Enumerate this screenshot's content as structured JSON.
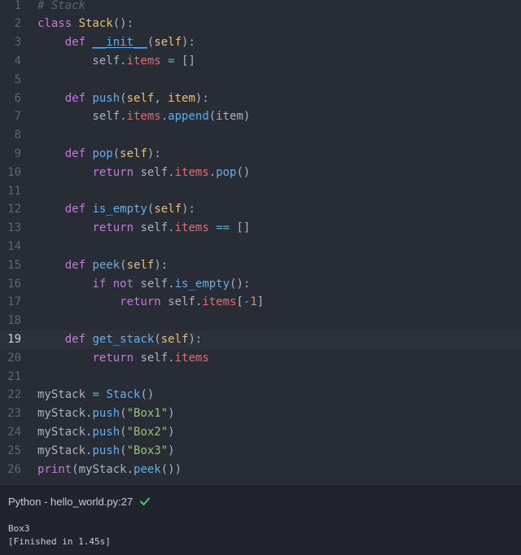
{
  "editor": {
    "active_line": 19,
    "lines": [
      {
        "n": "1",
        "tokens": [
          [
            "comment",
            "# Stack"
          ]
        ]
      },
      {
        "n": "2",
        "tokens": [
          [
            "keyword",
            "class "
          ],
          [
            "class",
            "Stack"
          ],
          [
            "plain",
            "():"
          ]
        ]
      },
      {
        "n": "3",
        "tokens": [
          [
            "plain",
            "    "
          ],
          [
            "keyword",
            "def "
          ],
          [
            "magic",
            "__init__"
          ],
          [
            "plain",
            "("
          ],
          [
            "self",
            "self"
          ],
          [
            "plain",
            "):"
          ]
        ]
      },
      {
        "n": "4",
        "tokens": [
          [
            "plain",
            "        self."
          ],
          [
            "prop",
            "items"
          ],
          [
            "plain",
            " "
          ],
          [
            "op",
            "="
          ],
          [
            "plain",
            " []"
          ]
        ]
      },
      {
        "n": "5",
        "tokens": []
      },
      {
        "n": "6",
        "tokens": [
          [
            "plain",
            "    "
          ],
          [
            "keyword",
            "def "
          ],
          [
            "func",
            "push"
          ],
          [
            "plain",
            "("
          ],
          [
            "self",
            "self"
          ],
          [
            "plain",
            ", "
          ],
          [
            "self",
            "item"
          ],
          [
            "plain",
            "):"
          ]
        ]
      },
      {
        "n": "7",
        "tokens": [
          [
            "plain",
            "        self."
          ],
          [
            "prop",
            "items"
          ],
          [
            "plain",
            "."
          ],
          [
            "func",
            "append"
          ],
          [
            "plain",
            "(item)"
          ]
        ]
      },
      {
        "n": "8",
        "tokens": []
      },
      {
        "n": "9",
        "tokens": [
          [
            "plain",
            "    "
          ],
          [
            "keyword",
            "def "
          ],
          [
            "func",
            "pop"
          ],
          [
            "plain",
            "("
          ],
          [
            "self",
            "self"
          ],
          [
            "plain",
            "):"
          ]
        ]
      },
      {
        "n": "10",
        "tokens": [
          [
            "plain",
            "        "
          ],
          [
            "keyword",
            "return "
          ],
          [
            "plain",
            "self."
          ],
          [
            "prop",
            "items"
          ],
          [
            "plain",
            "."
          ],
          [
            "func",
            "pop"
          ],
          [
            "plain",
            "()"
          ]
        ]
      },
      {
        "n": "11",
        "tokens": []
      },
      {
        "n": "12",
        "tokens": [
          [
            "plain",
            "    "
          ],
          [
            "keyword",
            "def "
          ],
          [
            "func",
            "is_empty"
          ],
          [
            "plain",
            "("
          ],
          [
            "self",
            "self"
          ],
          [
            "plain",
            "):"
          ]
        ]
      },
      {
        "n": "13",
        "tokens": [
          [
            "plain",
            "        "
          ],
          [
            "keyword",
            "return "
          ],
          [
            "plain",
            "self."
          ],
          [
            "prop",
            "items"
          ],
          [
            "plain",
            " "
          ],
          [
            "op",
            "=="
          ],
          [
            "plain",
            " []"
          ]
        ]
      },
      {
        "n": "14",
        "tokens": []
      },
      {
        "n": "15",
        "tokens": [
          [
            "plain",
            "    "
          ],
          [
            "keyword",
            "def "
          ],
          [
            "func",
            "peek"
          ],
          [
            "plain",
            "("
          ],
          [
            "self",
            "self"
          ],
          [
            "plain",
            "):"
          ]
        ]
      },
      {
        "n": "16",
        "tokens": [
          [
            "plain",
            "        "
          ],
          [
            "keyword",
            "if not "
          ],
          [
            "plain",
            "self."
          ],
          [
            "func",
            "is_empty"
          ],
          [
            "plain",
            "():"
          ]
        ]
      },
      {
        "n": "17",
        "tokens": [
          [
            "plain",
            "            "
          ],
          [
            "keyword",
            "return "
          ],
          [
            "plain",
            "self."
          ],
          [
            "prop",
            "items"
          ],
          [
            "plain",
            "["
          ],
          [
            "op",
            "-"
          ],
          [
            "num",
            "1"
          ],
          [
            "plain",
            "]"
          ]
        ]
      },
      {
        "n": "18",
        "tokens": []
      },
      {
        "n": "19",
        "tokens": [
          [
            "plain",
            "    "
          ],
          [
            "keyword",
            "def "
          ],
          [
            "func",
            "get_stack"
          ],
          [
            "plain",
            "("
          ],
          [
            "self",
            "self"
          ],
          [
            "plain",
            "):"
          ]
        ]
      },
      {
        "n": "20",
        "tokens": [
          [
            "plain",
            "        "
          ],
          [
            "keyword",
            "return "
          ],
          [
            "plain",
            "self."
          ],
          [
            "prop",
            "items"
          ]
        ]
      },
      {
        "n": "21",
        "tokens": []
      },
      {
        "n": "22",
        "tokens": [
          [
            "plain",
            "myStack "
          ],
          [
            "op",
            "="
          ],
          [
            "plain",
            " "
          ],
          [
            "func",
            "Stack"
          ],
          [
            "plain",
            "()"
          ]
        ]
      },
      {
        "n": "23",
        "tokens": [
          [
            "plain",
            "myStack."
          ],
          [
            "func",
            "push"
          ],
          [
            "plain",
            "("
          ],
          [
            "str",
            "\"Box1\""
          ],
          [
            "plain",
            ")"
          ]
        ]
      },
      {
        "n": "24",
        "tokens": [
          [
            "plain",
            "myStack."
          ],
          [
            "func",
            "push"
          ],
          [
            "plain",
            "("
          ],
          [
            "str",
            "\"Box2\""
          ],
          [
            "plain",
            ")"
          ]
        ]
      },
      {
        "n": "25",
        "tokens": [
          [
            "plain",
            "myStack."
          ],
          [
            "func",
            "push"
          ],
          [
            "plain",
            "("
          ],
          [
            "str",
            "\"Box3\""
          ],
          [
            "plain",
            ")"
          ]
        ]
      },
      {
        "n": "26",
        "tokens": [
          [
            "keyword",
            "print"
          ],
          [
            "plain",
            "(myStack."
          ],
          [
            "func",
            "peek"
          ],
          [
            "plain",
            "())"
          ]
        ]
      }
    ]
  },
  "status": {
    "text": "Python - hello_world.py:27",
    "icon": "check-icon",
    "icon_color": "#4ec77a"
  },
  "output": {
    "lines": [
      "Box3",
      "[Finished in 1.45s]"
    ]
  },
  "colors": {
    "editor_bg": "#282c34",
    "panel_bg": "#21252b",
    "keyword": "#c678dd",
    "function": "#61afef",
    "class": "#e5c07b",
    "property": "#e06c75",
    "string": "#98c379",
    "number": "#d19a66",
    "operator": "#56b6c2",
    "comment": "#5c6370"
  }
}
